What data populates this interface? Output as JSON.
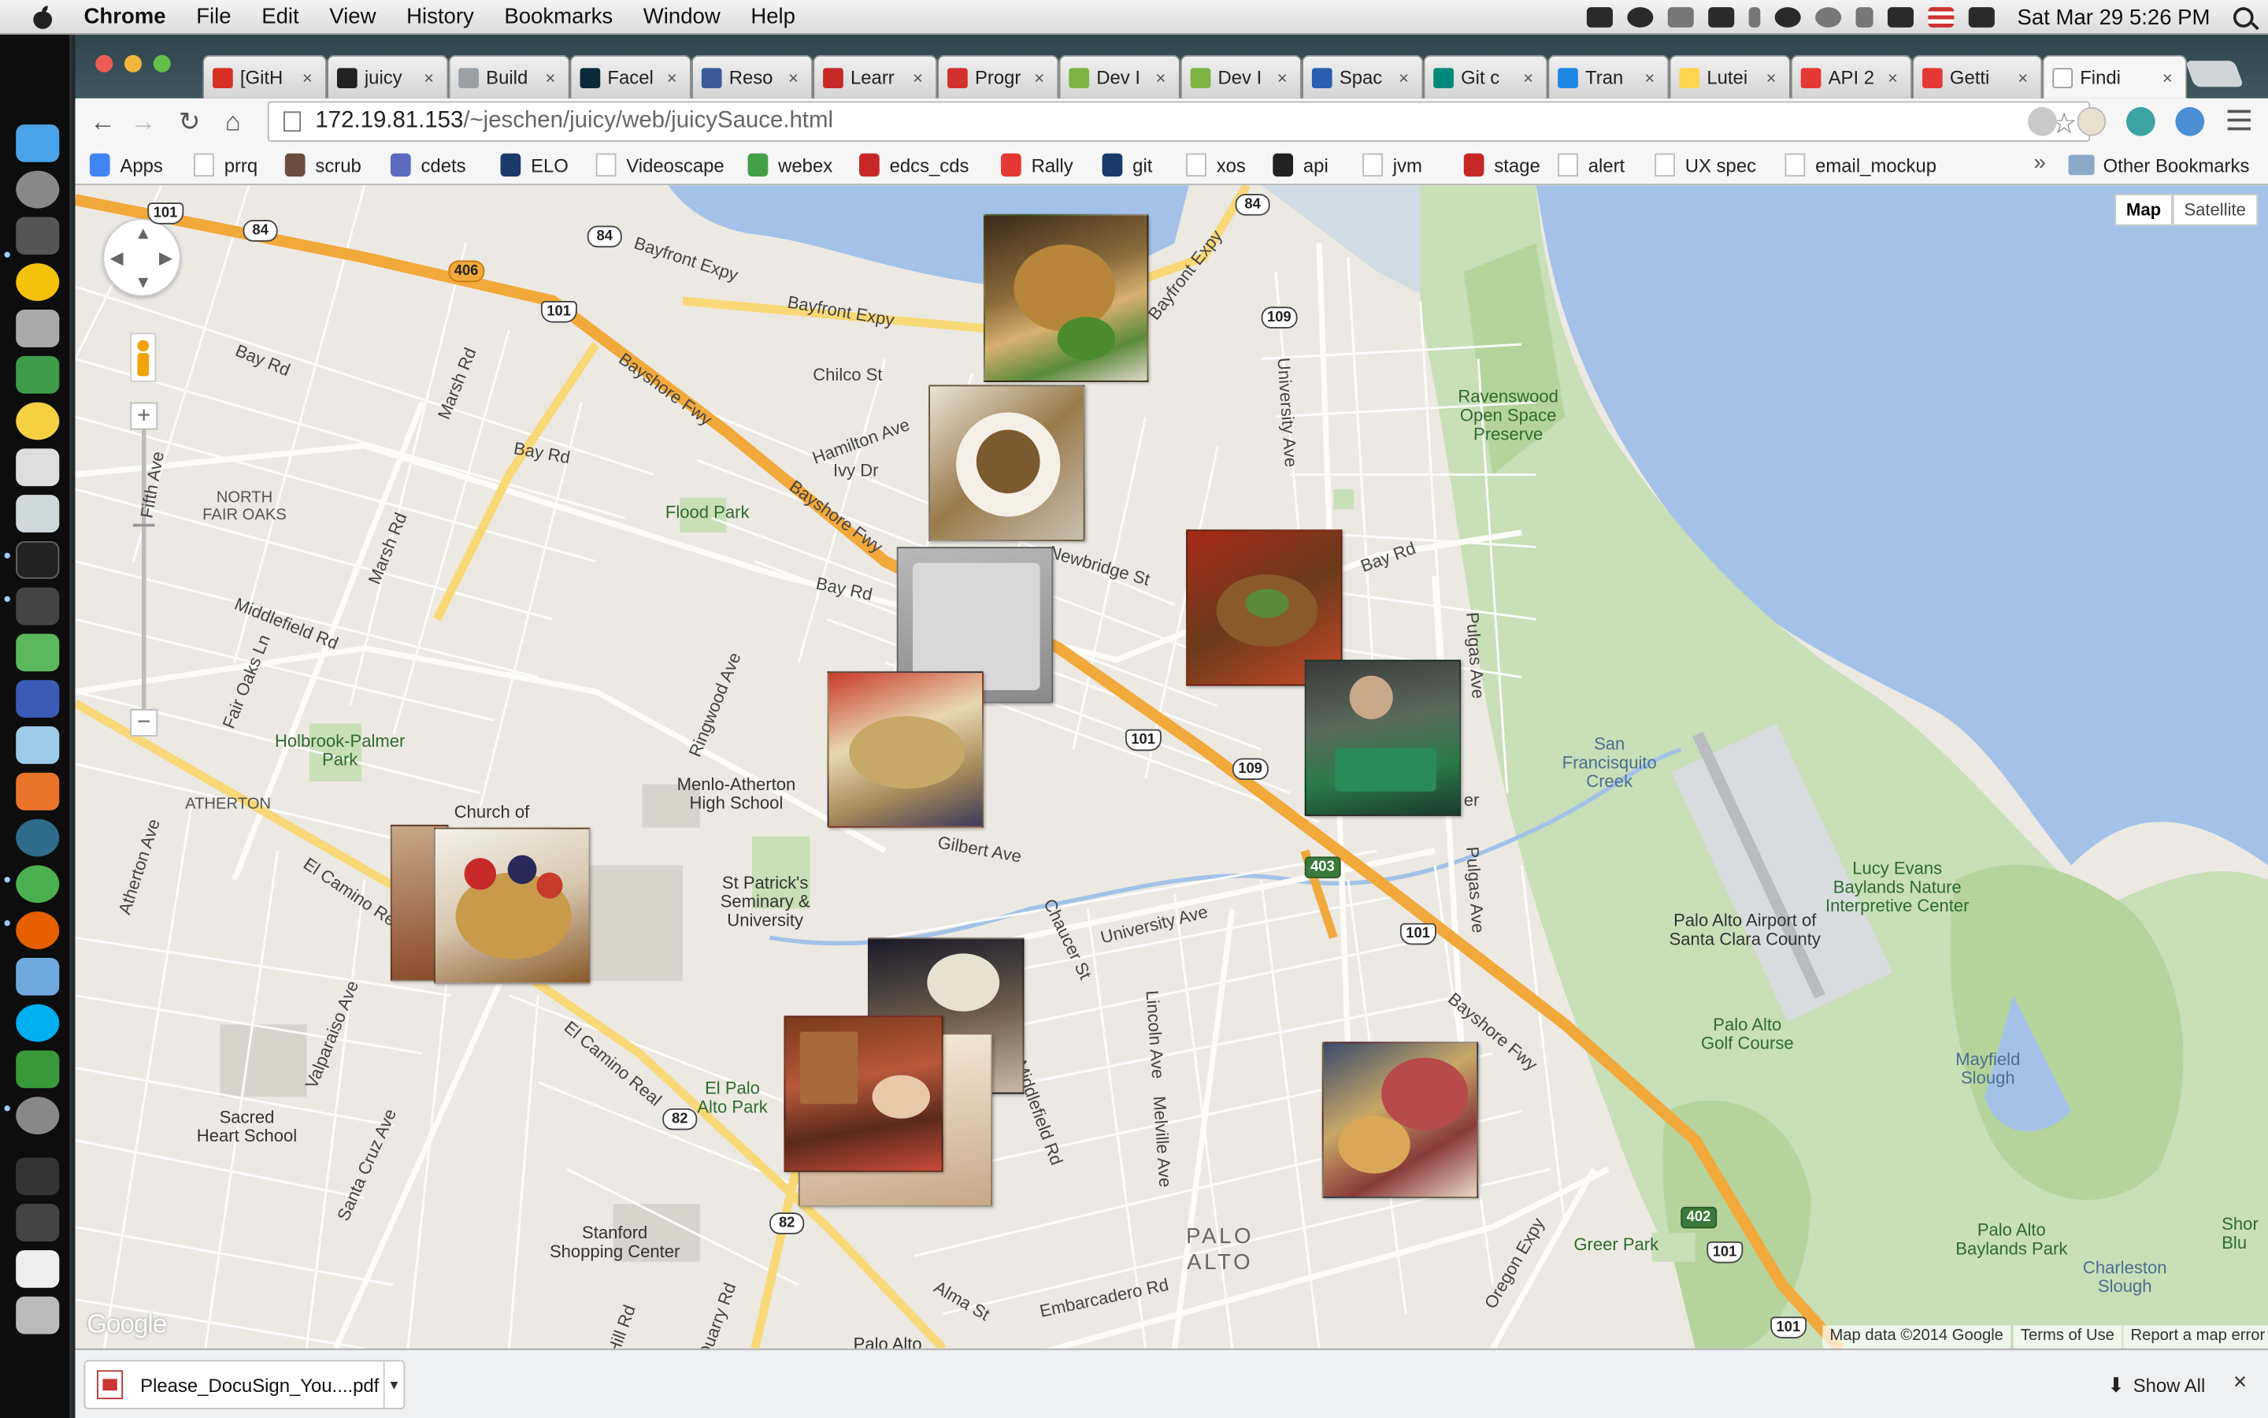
{
  "menubar": {
    "app": "Chrome",
    "items": [
      "File",
      "Edit",
      "View",
      "History",
      "Bookmarks",
      "Window",
      "Help"
    ],
    "clock": "Sat Mar 29  5:26 PM"
  },
  "tabs": [
    {
      "title": "[GitH",
      "color": "#d93025"
    },
    {
      "title": "juicy",
      "color": "#222222"
    },
    {
      "title": "Build",
      "color": "#9aa0a6"
    },
    {
      "title": "Facel",
      "color": "#0a2a3a"
    },
    {
      "title": "Reso",
      "color": "#3b5998"
    },
    {
      "title": "Learr",
      "color": "#c62828"
    },
    {
      "title": "Progr",
      "color": "#d32f2f"
    },
    {
      "title": "Dev I",
      "color": "#7cb342"
    },
    {
      "title": "Dev I",
      "color": "#7cb342"
    },
    {
      "title": "Spac",
      "color": "#2a5db0"
    },
    {
      "title": "Git c",
      "color": "#00897b"
    },
    {
      "title": "Tran",
      "color": "#1e88e5"
    },
    {
      "title": "Lutei",
      "color": "#ffd54f"
    },
    {
      "title": "API 2",
      "color": "#e53935"
    },
    {
      "title": "Getti",
      "color": "#e53935"
    },
    {
      "title": "Findi",
      "color": "#ffffff"
    }
  ],
  "address": {
    "host": "172.19.81.153",
    "path": "/~jeschen/juicy/web/juicySauce.html"
  },
  "bookmarks": [
    {
      "label": "Apps",
      "color": "#4285f4"
    },
    {
      "label": "prrq",
      "color": "#ffffff"
    },
    {
      "label": "scrub",
      "color": "#6d4c41"
    },
    {
      "label": "cdets",
      "color": "#5c6bc0"
    },
    {
      "label": "ELO",
      "color": "#1a3a6a"
    },
    {
      "label": "Videoscape",
      "color": "#ffffff"
    },
    {
      "label": "webex",
      "color": "#43a047"
    },
    {
      "label": "edcs_cds",
      "color": "#c62828"
    },
    {
      "label": "Rally",
      "color": "#e53935"
    },
    {
      "label": "git",
      "color": "#1a3a6a"
    },
    {
      "label": "xos",
      "color": "#ffffff"
    },
    {
      "label": "api",
      "color": "#222222"
    },
    {
      "label": "jvm",
      "color": "#ffffff"
    },
    {
      "label": "stage",
      "color": "#c62828"
    },
    {
      "label": "alert",
      "color": "#ffffff"
    },
    {
      "label": "UX spec",
      "color": "#ffffff"
    },
    {
      "label": "email_mockup",
      "color": "#ffffff"
    }
  ],
  "other_bookmarks": "Other Bookmarks",
  "map": {
    "type_buttons": [
      "Map",
      "Satellite"
    ],
    "labels": {
      "bayfront1": "Bayfront Expy",
      "bayfront2": "Bayfront Expy",
      "bayfront3": "Bayfront Expy",
      "bayrd1": "Bay Rd",
      "bayrd2": "Bay Rd",
      "bayrd3": "Bay Rd",
      "bayrd4": "Bay Rd",
      "chilco": "Chilco St",
      "hamilton": "Hamilton Ave",
      "ivy": "Ivy Dr",
      "marsh1": "Marsh Rd",
      "marsh2": "Marsh Rd",
      "fifth": "Fifth Ave",
      "nfo": "NORTH\nFAIR OAKS",
      "flood": "Flood Park",
      "bayshore1": "Bayshore Fwy",
      "bayshore2": "Bayshore Fwy",
      "bayshore3": "Bayshore Fwy",
      "middlefield": "Middlefield Rd",
      "fairoaks": "Fair Oaks Ln",
      "ringwood": "Ringwood Ave",
      "holbrook": "Holbrook-Palmer\nPark",
      "atherton": "ATHERTON",
      "menlo": "Menlo-Atherton\nHigh School",
      "church": "Church of",
      "gilbert": "Gilbert Ave",
      "stpat": "St Patrick's\nSeminary &\nUniversity",
      "ecr1": "El Camino Real",
      "ecr2": "El Camino Real",
      "athave": "Atherton Ave",
      "valparaiso": "Valparaiso Ave",
      "sacred": "Sacred\nHeart School",
      "santacruz": "Santa Cruz Ave",
      "elpalo": "El Palo\nAlto Park",
      "stanford": "Stanford\nShopping Center",
      "chaucer": "Chaucer St",
      "univ1": "University Ave",
      "univ2": "University Ave",
      "lincoln": "Lincoln Ave",
      "melville": "Melville Ave",
      "middle2": "Middlefield Rd",
      "newbridge": "Newbridge St",
      "pulgas1": "Pulgas Ave",
      "pulgas2": "Pulgas Ave",
      "ravenswood": "Ravenswood\nOpen Space\nPreserve",
      "sfcreek": "San\nFrancisquito\nCreek",
      "lucy": "Lucy Evans\nBaylands Nature\nInterpretive Center",
      "airport": "Palo Alto Airport of\nSanta Clara County",
      "golf": "Palo Alto\nGolf Course",
      "mayfield": "Mayfield\nSlough",
      "paloalto": "PALO\nALTO",
      "embarcadero": "Embarcadero Rd",
      "alma": "Alma St",
      "greer": "Greer Park",
      "oregon": "Oregon Expy",
      "baylands": "Palo Alto\nBaylands Park",
      "charleston": "Charleston\nSlough",
      "shore": "Shor\nBlu",
      "paloalto2": "Palo Alto",
      "quarry": "Quarry Rd",
      "hill": "Hill Rd",
      "er": "er"
    },
    "shields": [
      "101",
      "84",
      "406",
      "84",
      "101",
      "84",
      "109",
      "101",
      "109",
      "403",
      "101",
      "82",
      "82",
      "402",
      "101",
      "101"
    ],
    "attribution": [
      "Map data ©2014 Google",
      "Terms of Use",
      "Report a map error"
    ],
    "logo": "Google"
  },
  "download": {
    "filename": "Please_DocuSign_You....pdf",
    "show_all": "Show All"
  }
}
